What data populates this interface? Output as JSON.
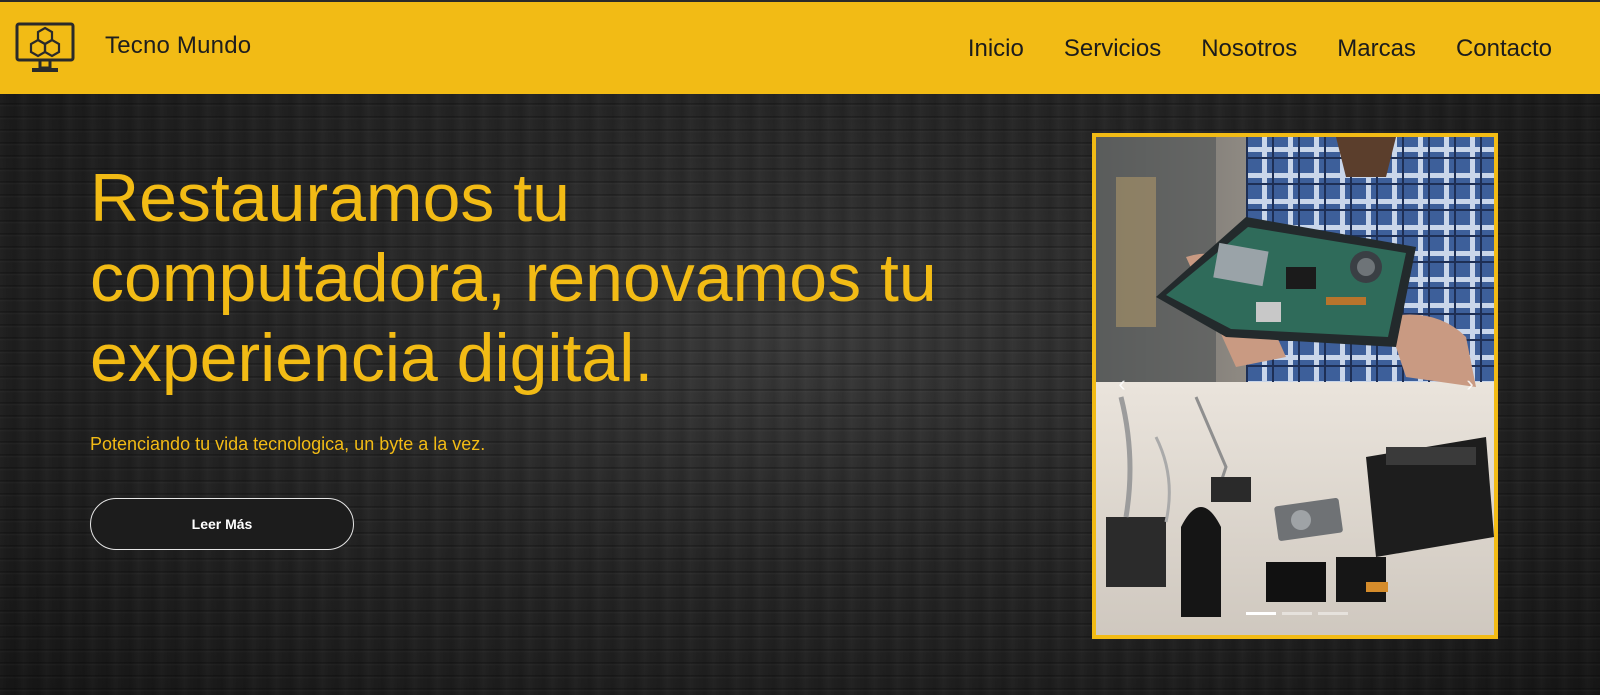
{
  "brand": {
    "name": "Tecno Mundo",
    "logo_icon": "monitor-hexagon-icon"
  },
  "nav": {
    "items": [
      {
        "label": "Inicio"
      },
      {
        "label": "Servicios"
      },
      {
        "label": "Nosotros"
      },
      {
        "label": "Marcas"
      },
      {
        "label": "Contacto"
      }
    ]
  },
  "hero": {
    "headline": "Restauramos tu computadora, renovamos tu experiencia digital.",
    "tagline": "Potenciando tu vida tecnologica, un byte a la vez.",
    "cta_label": "Leer Más"
  },
  "carousel": {
    "prev_icon": "chevron-left-icon",
    "next_icon": "chevron-right-icon",
    "slide_count": 3,
    "active_index": 0
  },
  "colors": {
    "accent": "#f2bb15",
    "background": "#222222",
    "button_bg": "#1c1c1c"
  }
}
